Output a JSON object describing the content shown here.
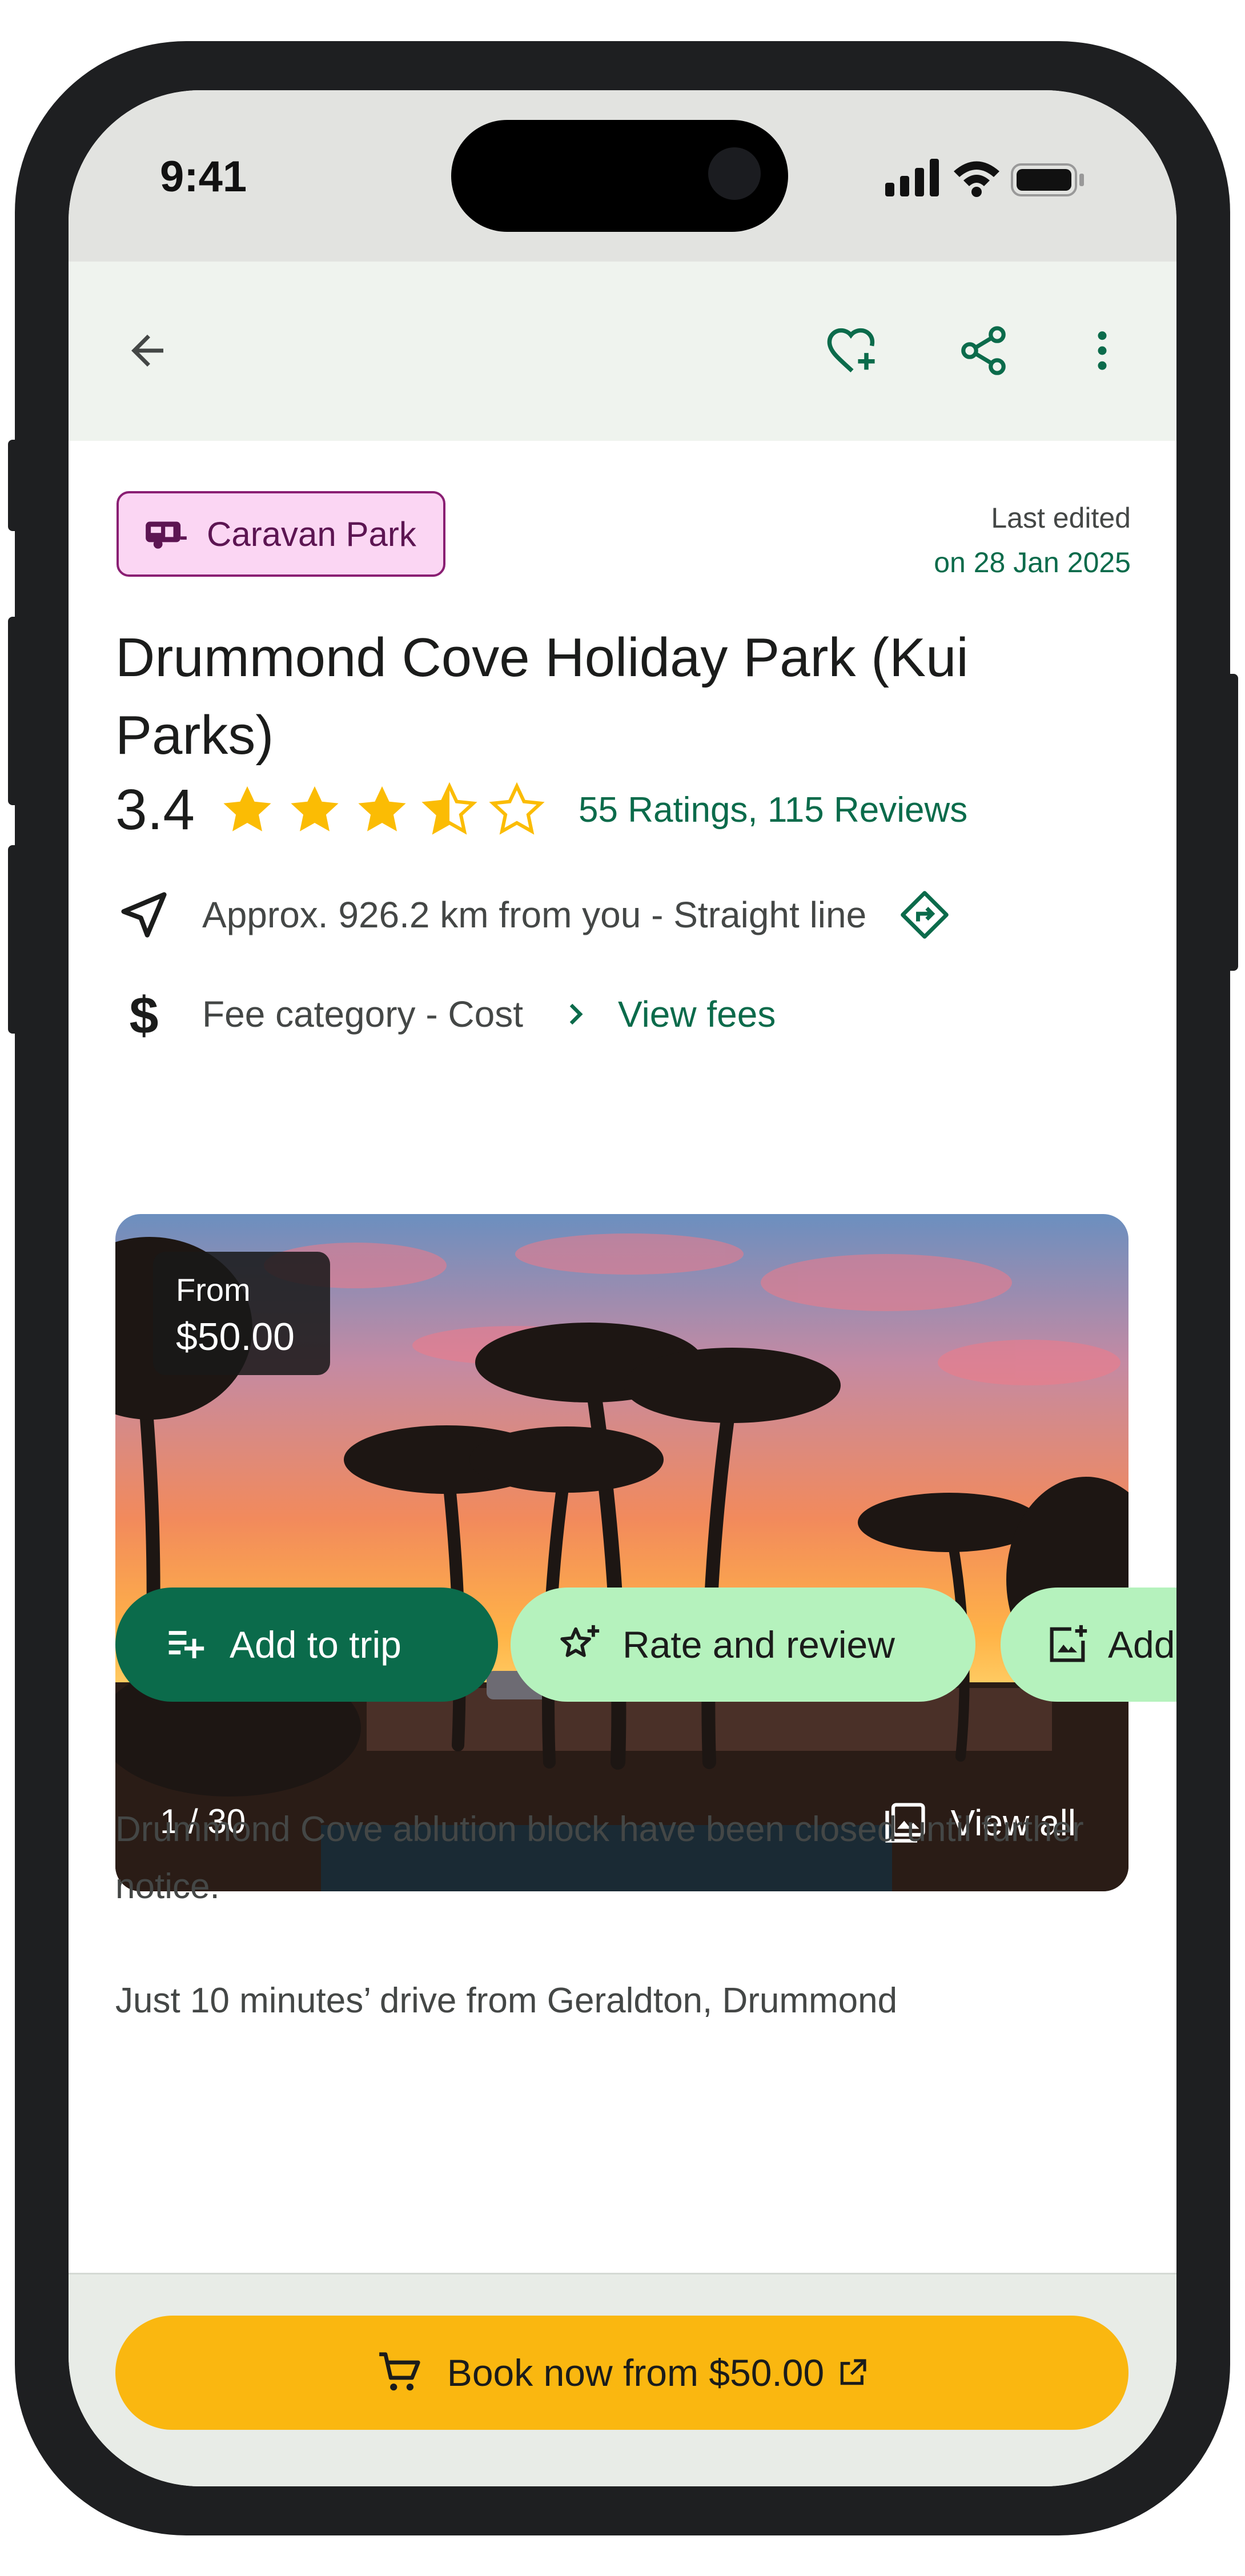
{
  "status_bar": {
    "time": "9:41"
  },
  "header": {
    "back_icon": "arrow-left-icon",
    "favorite_icon": "heart-plus-icon",
    "share_icon": "share-icon",
    "more_icon": "more-vertical-icon"
  },
  "category": {
    "label": "Caravan Park",
    "icon": "caravan-icon"
  },
  "last_edited": {
    "label": "Last edited",
    "date": "on 28 Jan 2025"
  },
  "place": {
    "title": "Drummond Cove Holiday Park (Kui Parks)"
  },
  "rating": {
    "value": "3.4",
    "stars": 3.5,
    "max_stars": 5,
    "summary": "55 Ratings, 115 Reviews"
  },
  "distance": {
    "text": "Approx. 926.2 km from you - Straight line",
    "icon": "navigation-icon",
    "directions_icon": "directions-icon"
  },
  "fees": {
    "text": "Fee category - Cost",
    "icon": "dollar-icon",
    "link": "View fees",
    "chevron": "chevron-right-icon"
  },
  "gallery": {
    "price_from": "From",
    "price_amount": "$50.00",
    "counter": "1 / 30",
    "view_all": "View all"
  },
  "actions": {
    "add_to_trip": "Add to trip",
    "rate_and_review": "Rate and review",
    "add_photo": "Add photo"
  },
  "description": [
    "Drummond Cove ablution block have been closed until further notice.",
    "Just 10 minutes’ drive from Geraldton, Drummond"
  ],
  "booking": {
    "label": "Book now from $50.00",
    "external_icon": "external-link-icon",
    "cart_icon": "cart-icon"
  },
  "colors": {
    "brand_green": "#0b6b4b",
    "accent_light_green": "#b5f2bd",
    "chip_bg": "#fbd6f3",
    "chip_border": "#8a1f73",
    "star": "#fbbc04",
    "book_button": "#fab710"
  }
}
